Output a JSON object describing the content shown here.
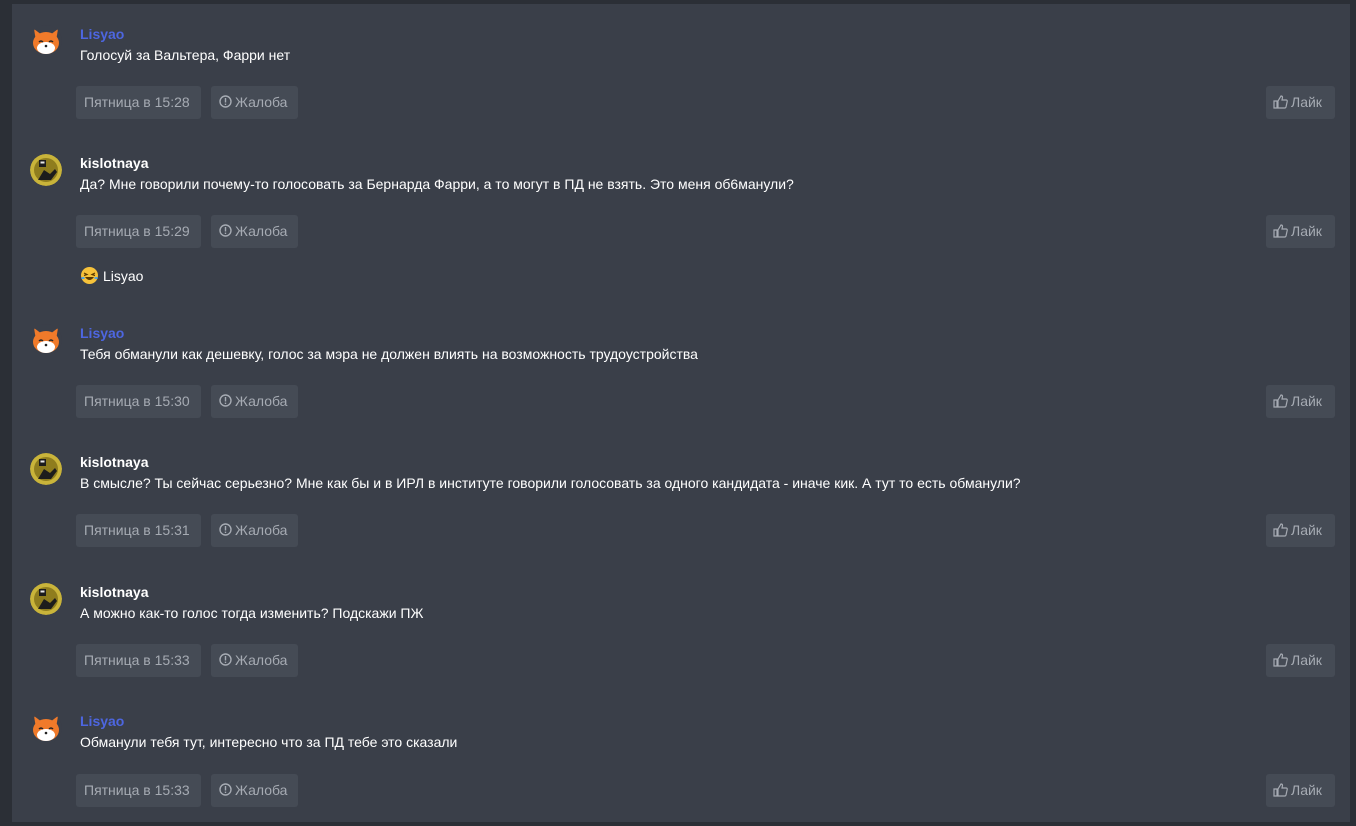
{
  "colors": {
    "panel_bg": "#3a3f49",
    "button_bg": "#454b55",
    "button_text": "#a6abb3",
    "author_blue": "#4d66e0"
  },
  "labels": {
    "report": "Жалоба",
    "like": "Лайк"
  },
  "messages": [
    {
      "author": "Lisyao",
      "author_style": "blue",
      "avatar": "fox-avatar",
      "text": "Голосуй за Вальтера, Фарри нет",
      "time": "Пятница в 15:28"
    },
    {
      "author": "kislotnaya",
      "author_style": "white",
      "avatar": "gold-avatar",
      "text": "Да? Мне говорили почему-то голосовать за Бернарда Фарри, а то могут в ПД не взять. Это меня об6манули?",
      "time": "Пятница в 15:29",
      "reaction": {
        "emoji": "laughing-emoji-icon",
        "user": "Lisyao"
      }
    },
    {
      "author": "Lisyao",
      "author_style": "blue",
      "avatar": "fox-avatar",
      "text": "Тебя обманули как дешевку, голос за мэра не должен влиять на возможность трудоустройства",
      "time": "Пятница в 15:30"
    },
    {
      "author": "kislotnaya",
      "author_style": "white",
      "avatar": "gold-avatar",
      "text": "В смысле? Ты сейчас серьезно? Мне как бы и в ИРЛ в институте говорили голосовать за одного кандидата - иначе кик. А тут то есть обманули?",
      "time": "Пятница в 15:31"
    },
    {
      "author": "kislotnaya",
      "author_style": "white",
      "avatar": "gold-avatar",
      "text": "А можно как-то голос тогда изменить? Подскажи ПЖ",
      "time": "Пятница в 15:33"
    },
    {
      "author": "Lisyao",
      "author_style": "blue",
      "avatar": "fox-avatar",
      "text": "Обманули тебя тут, интересно что за ПД тебе это сказали",
      "time": "Пятница в 15:33"
    }
  ]
}
